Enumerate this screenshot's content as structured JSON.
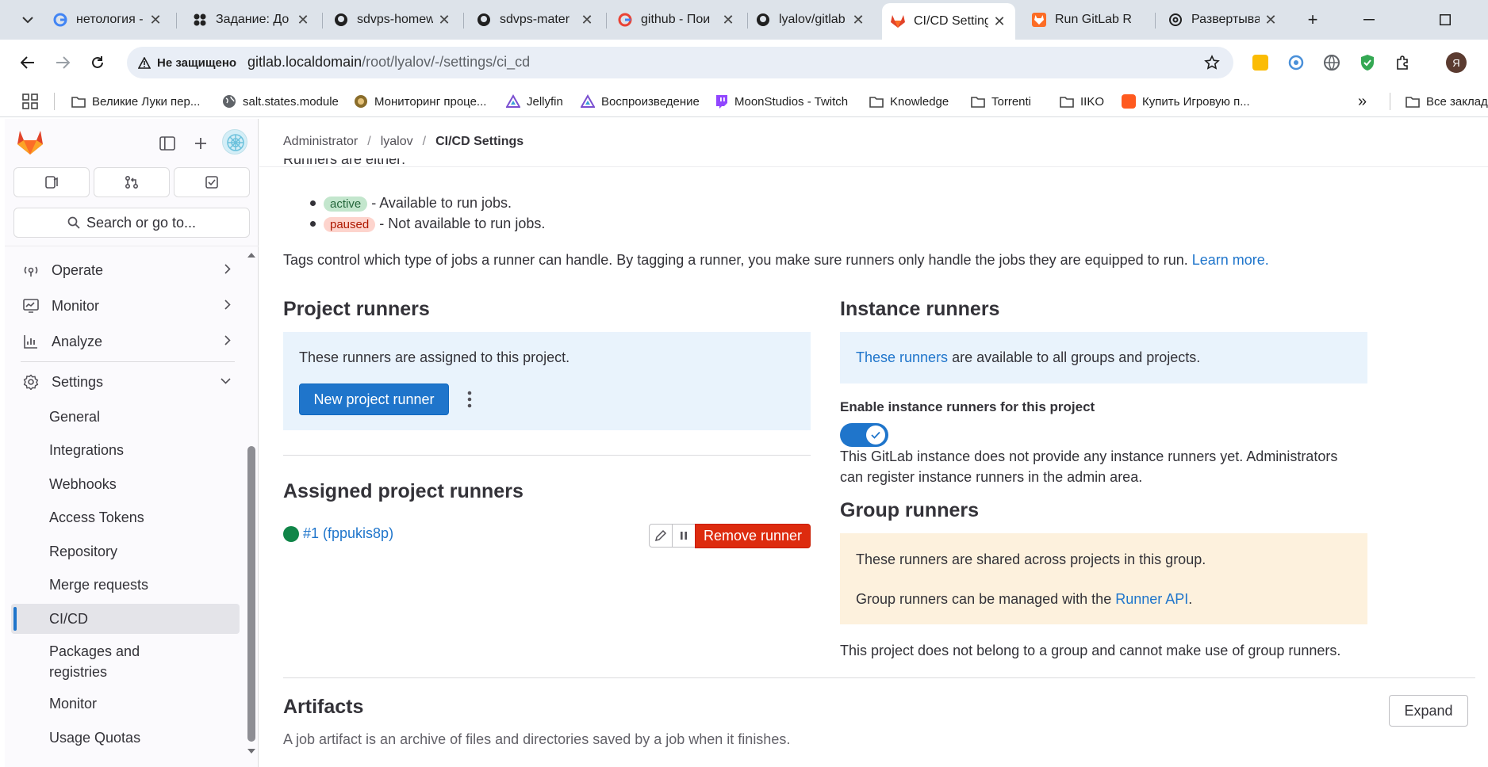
{
  "browser": {
    "tabs": [
      {
        "title": "нетология - ",
        "icon": "google-icon"
      },
      {
        "title": "Задание: До",
        "icon": "taskapp-icon"
      },
      {
        "title": "sdvps-homew",
        "icon": "github-icon"
      },
      {
        "title": "sdvps-mater",
        "icon": "github-icon"
      },
      {
        "title": "github - Пои",
        "icon": "google-icon"
      },
      {
        "title": "lyalov/gitlab",
        "icon": "github-icon"
      },
      {
        "title": "CI/CD Setting",
        "icon": "gitlab-icon",
        "active": true
      },
      {
        "title": "Run GitLab R",
        "icon": "gitlab-orange-icon"
      },
      {
        "title": "Развертыван",
        "icon": "openai-icon"
      }
    ],
    "security_label": "Не защищено",
    "url_host": "gitlab.localdomain",
    "url_path": "/root/lyalov/-/settings/ci_cd",
    "bookmarks": [
      {
        "label": "Великие Луки пер...",
        "icon": "folder-icon"
      },
      {
        "label": "salt.states.module",
        "icon": "globe-icon"
      },
      {
        "label": "Мониторинг проце...",
        "icon": "site-icon"
      },
      {
        "label": "Jellyfin",
        "icon": "jellyfin-icon"
      },
      {
        "label": "Воспроизведение",
        "icon": "jellyfin-icon"
      },
      {
        "label": "MoonStudios - Twitch",
        "icon": "twitch-icon"
      },
      {
        "label": "Knowledge",
        "icon": "folder-icon"
      },
      {
        "label": "Torrenti",
        "icon": "folder-icon"
      },
      {
        "label": "IIKO",
        "icon": "folder-icon"
      },
      {
        "label": "Купить Игровую п...",
        "icon": "shop-icon"
      }
    ],
    "all_bookmarks_label": "Все заклад",
    "profile_initial": "Я",
    "colors": {
      "tabbar": "#dde3ea",
      "omnibox": "#e9eef6"
    }
  },
  "sidebar": {
    "search_label": "Search or go to...",
    "top_items": [
      {
        "label": "Operate",
        "icon": "operate-icon"
      },
      {
        "label": "Monitor",
        "icon": "monitor-icon"
      },
      {
        "label": "Analyze",
        "icon": "analyze-icon"
      },
      {
        "label": "Settings",
        "icon": "settings-icon",
        "expanded": true
      }
    ],
    "settings_items": [
      {
        "label": "General"
      },
      {
        "label": "Integrations"
      },
      {
        "label": "Webhooks"
      },
      {
        "label": "Access Tokens"
      },
      {
        "label": "Repository"
      },
      {
        "label": "Merge requests"
      },
      {
        "label": "CI/CD",
        "active": true
      },
      {
        "label": "Packages and"
      },
      {
        "label": "registries"
      },
      {
        "label": "Monitor"
      },
      {
        "label": "Usage Quotas"
      }
    ]
  },
  "breadcrumb": {
    "items": [
      "Administrator",
      "lyalov"
    ],
    "current": "CI/CD Settings"
  },
  "main": {
    "intro_cut": "Runners are either:",
    "status_active": "active",
    "status_active_desc": "- Available to run jobs.",
    "status_paused": "paused",
    "status_paused_desc": "- Not available to run jobs.",
    "tags_text": "Tags control which type of jobs a runner can handle. By tagging a runner, you make sure runners only handle the jobs they are equipped to run.",
    "learn_more": "Learn more.",
    "project_runners": {
      "title": "Project runners",
      "info": "These runners are assigned to this project.",
      "new_button": "New project runner"
    },
    "assigned": {
      "title": "Assigned project runners",
      "runner_link": "#1 (fppukis8p)",
      "remove_button": "Remove runner"
    },
    "instance_runners": {
      "title": "Instance runners",
      "info_link": "These runners",
      "info_rest": "are available to all groups and projects.",
      "toggle_label": "Enable instance runners for this project",
      "toggle_on": true,
      "note_line1": "This GitLab instance does not provide any instance runners yet. Administrators",
      "note_line2": "can register instance runners in the admin area."
    },
    "group_runners": {
      "title": "Group runners",
      "info1": "These runners are shared across projects in this group.",
      "info2_prefix": "Group runners can be managed with the",
      "info2_link": "Runner API",
      "info2_suffix": ".",
      "note": "This project does not belong to a group and cannot make use of group runners."
    },
    "artifacts": {
      "title": "Artifacts",
      "desc": "A job artifact is an archive of files and directories saved by a job when it finishes.",
      "expand_button": "Expand"
    }
  },
  "colors": {
    "accent": "#1f75cb",
    "danger": "#dd2b0e",
    "success": "#108548"
  }
}
